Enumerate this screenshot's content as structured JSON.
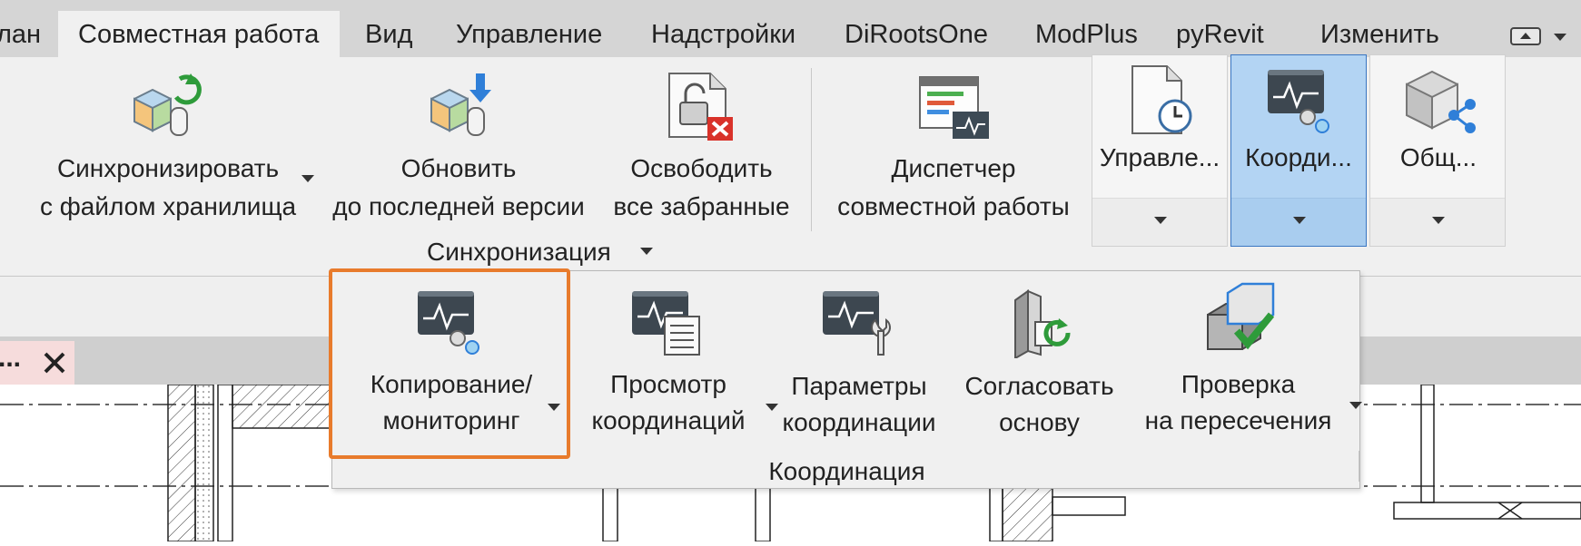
{
  "tabs": {
    "items": [
      "лан",
      "Совместная работа",
      "Вид",
      "Управление",
      "Надстройки",
      "DiRootsOne",
      "ModPlus",
      "pyRevit",
      "Изменить"
    ],
    "active": "Совместная работа"
  },
  "sync_panel": {
    "sync_line1": "Синхронизировать",
    "sync_line2": "с файлом хранилища",
    "update_line1": "Обновить",
    "update_line2": "до последней версии",
    "release_line1": "Освободить",
    "release_line2": "все забранные",
    "panel_label": "Синхронизация"
  },
  "worksharing": {
    "line1": "Диспетчер",
    "line2": "совместной работы"
  },
  "large_buttons": {
    "manage": "Управле...",
    "coord": "Коорди...",
    "share": "Общ..."
  },
  "doc_tab": {
    "label": "..."
  },
  "coordination_panel": {
    "copy_monitor_line1": "Копирование/",
    "copy_monitor_line2": "мониторинг",
    "review_line1": "Просмотр",
    "review_line2": "координаций",
    "settings_line1": "Параметры",
    "settings_line2": "координации",
    "reconcile_line1": "Согласовать",
    "reconcile_line2": "основу",
    "interference_line1": "Проверка",
    "interference_line2": "на пересечения",
    "panel_label": "Координация"
  },
  "colors": {
    "highlight": "#e87b2c",
    "selected_button": "#b3d4f3",
    "ribbon_bg": "#f0f0f0",
    "tab_bar_bg": "#d5d5d5"
  }
}
